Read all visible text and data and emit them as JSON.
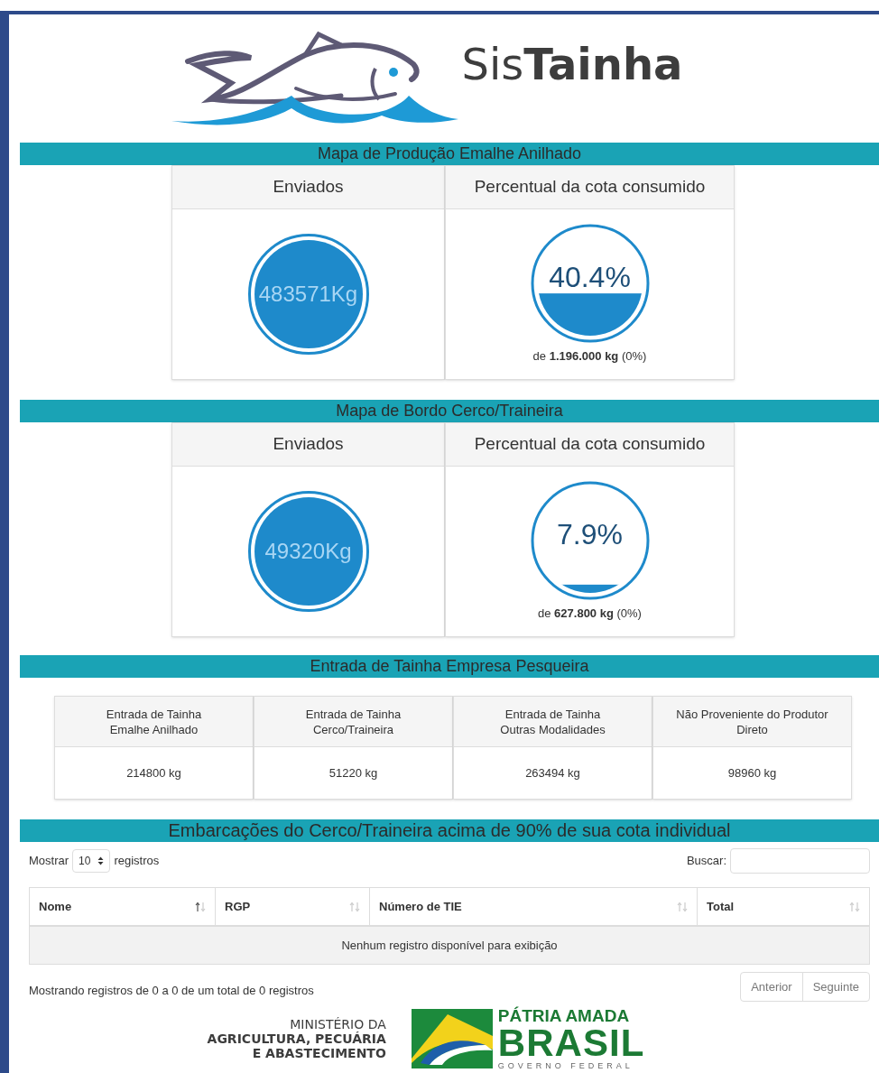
{
  "logo": {
    "text": "Sis**Tainha**"
  },
  "sections": [
    {
      "title": "Mapa de Produção Emalhe Anilhado",
      "kind": "gauges",
      "cards": [
        {
          "heading": "Enviados",
          "kind": "total",
          "value": "483571Kg"
        },
        {
          "heading": "Percentual da cota consumido",
          "kind": "percent",
          "value": "40.4%",
          "caption": "de **1.196.000 kg** (0%)"
        }
      ]
    },
    {
      "title": "Mapa de Bordo Cerco/Traineira",
      "kind": "gauges",
      "cards": [
        {
          "heading": "Enviados",
          "kind": "total",
          "value": "49320Kg"
        },
        {
          "heading": "Percentual da cota consumido",
          "kind": "percent",
          "value": "7.9%",
          "caption": "de **627.800 kg** (0%)"
        }
      ]
    },
    {
      "title": "Entrada de Tainha Empresa Pesqueira",
      "kind": "stats",
      "cards": [
        {
          "heading": "Entrada de Tainha\nEmalhe Anilhado",
          "value": "214800 kg"
        },
        {
          "heading": "Entrada de Tainha\nCerco/Traineira",
          "value": "51220 kg"
        },
        {
          "heading": "Entrada de Tainha\nOutras Modalidades",
          "value": "263494 kg"
        },
        {
          "heading": "Não Proveniente do Produtor\nDireto",
          "value": "98960 kg"
        }
      ]
    }
  ],
  "table": {
    "title": "Embarcações do Cerco/Traineira acima de 90% de sua cota individual",
    "length_before": "Mostrar",
    "length_value": "10",
    "length_after": "registros",
    "search_label": "Buscar:",
    "columns": [
      {
        "label": "Nome",
        "sorted": true
      },
      {
        "label": "RGP",
        "sorted": false
      },
      {
        "label": "Número de TIE",
        "sorted": false
      },
      {
        "label": "Total",
        "sorted": false
      }
    ],
    "empty_message": "Nenhum registro disponível para exibição",
    "info": "Mostrando registros de 0 a 0 de um total de 0 registros",
    "pagination": [
      {
        "label": "Anterior",
        "disabled": true
      },
      {
        "label": "Seguinte",
        "disabled": true
      }
    ]
  },
  "footer": {
    "ministry": [
      "MINISTÉRIO DA",
      "AGRICULTURA, PECUÁRIA",
      "E ABASTECIMENTO"
    ],
    "motto": "PÁTRIA AMADA",
    "country": "BRASIL",
    "government": "GOVERNO FEDERAL"
  }
}
